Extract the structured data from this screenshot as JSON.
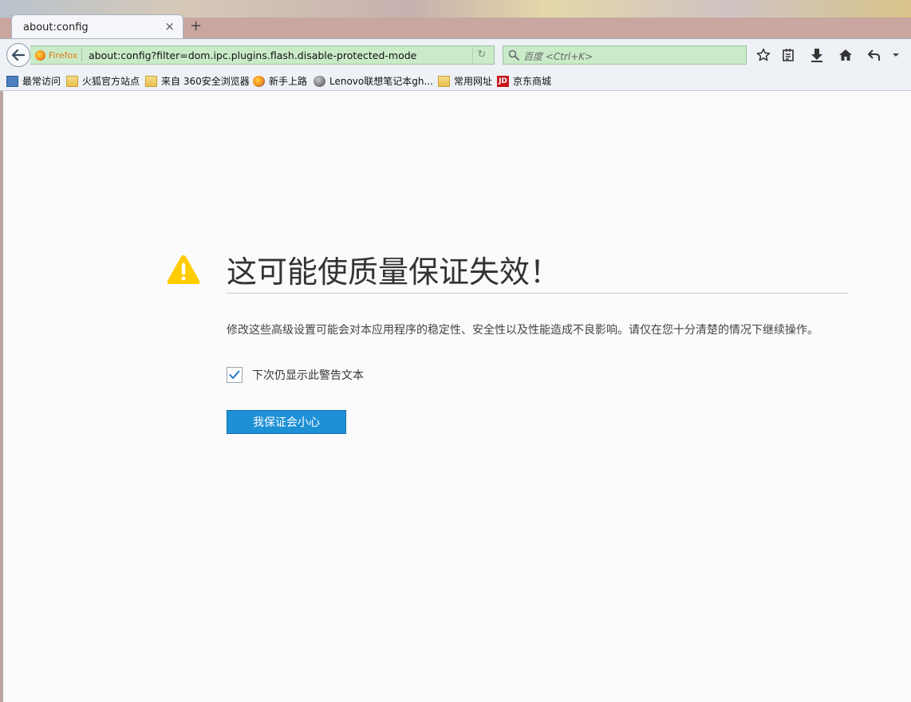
{
  "tab": {
    "title": "about:config",
    "close_glyph": "×",
    "new_tab_glyph": "+"
  },
  "toolbar": {
    "identity_label": "Firefox",
    "url": "about:config?filter=dom.ipc.plugins.flash.disable-protected-mode",
    "reload_glyph": "↻",
    "search_placeholder": "百度 <Ctrl+K>",
    "icons": [
      "back-arrow-icon",
      "star-icon",
      "reading-list-icon",
      "download-icon",
      "home-icon",
      "undo-icon",
      "dropdown-arrow-icon"
    ]
  },
  "bookmarks": [
    {
      "label": "最常访问",
      "icon": "most-visited-icon"
    },
    {
      "label": "火狐官方站点",
      "icon": "folder-icon"
    },
    {
      "label": "来自 360安全浏览器",
      "icon": "folder-icon"
    },
    {
      "label": "新手上路",
      "icon": "firefox-icon"
    },
    {
      "label": "Lenovo联想笔记本gh...",
      "icon": "globe-icon"
    },
    {
      "label": "常用网址",
      "icon": "folder-icon"
    },
    {
      "label": "京东商城",
      "icon": "jd-icon"
    }
  ],
  "warning": {
    "title": "这可能使质量保证失效！",
    "description": "修改这些高级设置可能会对本应用程序的稳定性、安全性以及性能造成不良影响。请仅在您十分清楚的情况下继续操作。",
    "checkbox_label": "下次仍显示此警告文本",
    "checkbox_checked": true,
    "button_label": "我保证会小心",
    "accent_color": "#1e90d6",
    "warning_color": "#ffcc00"
  },
  "bm_jd_text": "JD"
}
